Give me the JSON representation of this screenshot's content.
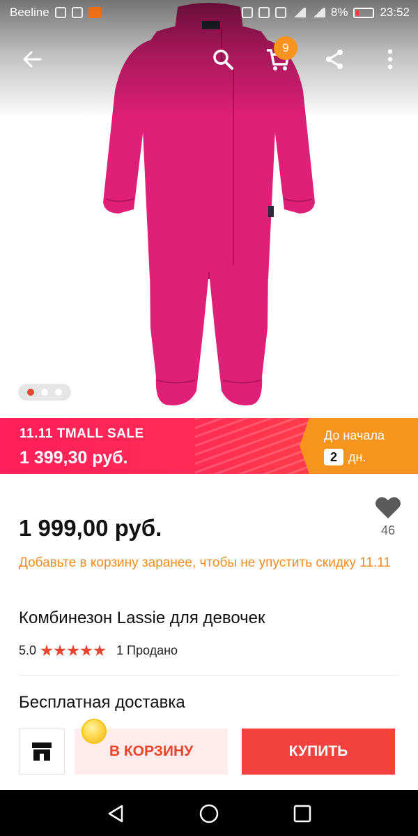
{
  "status_bar": {
    "carrier": "Beeline",
    "battery": "8%",
    "time": "23:52"
  },
  "toolbar": {
    "cart_count": "9",
    "icons": [
      "back-arrow-icon",
      "search-icon",
      "cart-icon",
      "share-icon",
      "more-icon"
    ]
  },
  "gallery": {
    "image_count": 3,
    "active_index": 0
  },
  "sale": {
    "title": "11.11 TMALL SALE",
    "price": "1 399,30 руб.",
    "countdown_label": "До начала",
    "countdown_days": "2",
    "countdown_unit": "дн."
  },
  "product": {
    "price": "1 999,00 руб.",
    "favorites_count": "46",
    "hint": "Добавьте в корзину заранее, чтобы не упустить скидку 11.11",
    "title": "Комбинезон Lassie для девочек",
    "rating": "5.0",
    "stars": 5,
    "sold": "1 Продано",
    "delivery": "Бесплатная доставка"
  },
  "actions": {
    "store_icon": "store-icon",
    "add_to_cart": "В КОРЗИНУ",
    "buy": "КУПИТЬ"
  },
  "colors": {
    "accent": "#e8442e",
    "sale_pink": "#ff2a55",
    "countdown_orange": "#f7941d",
    "hint_orange": "#f08c1d",
    "buy_red": "#f2413f",
    "product_pink": "#e01f78"
  }
}
